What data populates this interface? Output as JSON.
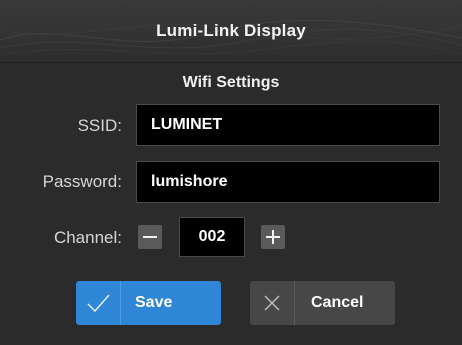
{
  "header": {
    "title": "Lumi-Link Display"
  },
  "section": {
    "title": "Wifi Settings"
  },
  "ssid": {
    "label": "SSID:",
    "value": "LUMINET"
  },
  "password": {
    "label": "Password:",
    "value": "lumishore"
  },
  "channel": {
    "label": "Channel:",
    "value": "002",
    "decrement_icon": "minus-icon",
    "increment_icon": "plus-icon"
  },
  "actions": {
    "save_label": "Save",
    "save_icon": "checkmark-icon",
    "cancel_label": "Cancel",
    "cancel_icon": "close-icon"
  },
  "colors": {
    "background": "#2b2b2b",
    "field_background": "#000000",
    "save_button": "#2f86d6",
    "cancel_button": "#474747",
    "stepper_button": "#5a5a5a"
  }
}
